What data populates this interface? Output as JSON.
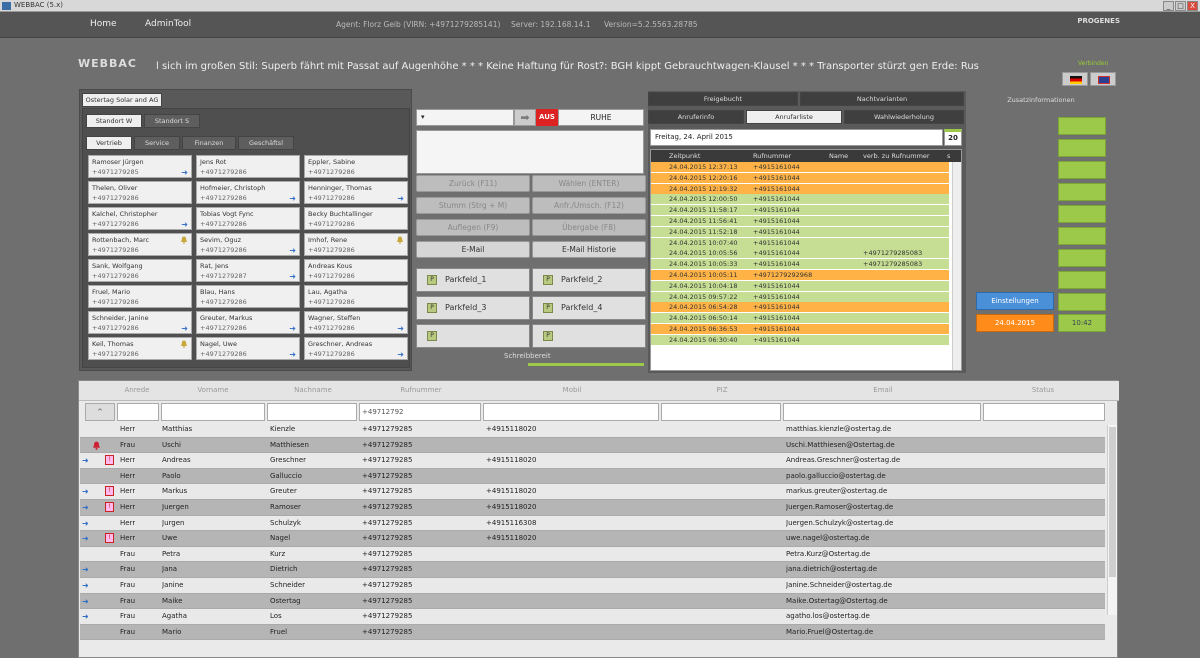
{
  "window": {
    "title": "WEBBAC (5.x)",
    "buttons": [
      "_",
      "□",
      "X"
    ]
  },
  "menu": {
    "home": "Home",
    "admin": "AdminTool",
    "agent": "Agent: Florz Geib  (VIRN: +4971279285141)",
    "server": "Server: 192.168.14.1",
    "version": "Version=5.2.5563.28785",
    "logo": "PROGENES"
  },
  "app_name": "WEBBAC",
  "ticker": "l sich im großen Stil: Superb fährt mit Passat auf Augenhöhe   * * *   Keine Haftung für Rost?: BGH kippt Gebrauchtwagen-Klausel   * * *   Transporter stürzt gen Erde: Rus",
  "green_label": "Verbinden",
  "colors": {
    "accent_green": "#9dc94a",
    "orange": "#ffb347",
    "blue": "#4a90d9"
  },
  "contacts_panel": {
    "company": "Ostertag Solar and AG",
    "location_tabs": [
      "Standort W",
      "Standort S"
    ],
    "dept_tabs": [
      "Vertrieb",
      "Service",
      "Finanzen",
      "Geschäftsl"
    ],
    "contacts": [
      {
        "name": "Ramoser Jürgen",
        "phone": "+4971279285",
        "arrow": true,
        "bell": false
      },
      {
        "name": "Jens Rot",
        "phone": "+4971279286",
        "arrow": false,
        "bell": false
      },
      {
        "name": "Eppler, Sabine",
        "phone": "+4971279286",
        "arrow": false,
        "bell": false
      },
      {
        "name": "Thelen, Oliver",
        "phone": "+4971279286",
        "arrow": false,
        "bell": false
      },
      {
        "name": "Hofmeier, Christoph",
        "phone": "+4971279286",
        "arrow": true,
        "bell": false
      },
      {
        "name": "Henninger, Thomas",
        "phone": "+4971279286",
        "arrow": true,
        "bell": false
      },
      {
        "name": "Kalchel, Christopher",
        "phone": "+4971279286",
        "arrow": true,
        "bell": false
      },
      {
        "name": "Tobias Vogt Fync",
        "phone": "+4971279286",
        "arrow": false,
        "bell": false
      },
      {
        "name": "Becky Buchtallinger",
        "phone": "+4971279286",
        "arrow": false,
        "bell": false
      },
      {
        "name": "Rottenbach, Marc",
        "phone": "+4971279286",
        "arrow": false,
        "bell": true
      },
      {
        "name": "Sevim, Oguz",
        "phone": "+4971279286",
        "arrow": true,
        "bell": false
      },
      {
        "name": "Imhof, Rene",
        "phone": "+4971279286",
        "arrow": false,
        "bell": true
      },
      {
        "name": "Sank, Wolfgang",
        "phone": "+4971279286",
        "arrow": false,
        "bell": false
      },
      {
        "name": "Rat, Jens",
        "phone": "+4971279287",
        "arrow": true,
        "bell": false
      },
      {
        "name": "Andreas Kous",
        "phone": "+4971279286",
        "arrow": false,
        "bell": false
      },
      {
        "name": "Fruel, Mario",
        "phone": "+4971279286",
        "arrow": false,
        "bell": false
      },
      {
        "name": "Blau, Hans",
        "phone": "+4971279286",
        "arrow": false,
        "bell": false
      },
      {
        "name": "Lau, Agatha",
        "phone": "+4971279286",
        "arrow": false,
        "bell": false
      },
      {
        "name": "Schneider, Janine",
        "phone": "+4971279286",
        "arrow": true,
        "bell": false
      },
      {
        "name": "Greuter, Markus",
        "phone": "+4971279286",
        "arrow": true,
        "bell": false
      },
      {
        "name": "Wagner, Steffen",
        "phone": "+4971279286",
        "arrow": true,
        "bell": false
      },
      {
        "name": "Keil, Thomas",
        "phone": "+4971279286",
        "arrow": false,
        "bell": true
      },
      {
        "name": "Nagel, Uwe",
        "phone": "+4971279286",
        "arrow": true,
        "bell": false
      },
      {
        "name": "Greschner, Andreas",
        "phone": "+4971279286",
        "arrow": true,
        "bell": false
      }
    ]
  },
  "phone": {
    "line_value": "",
    "aus": "AUS",
    "ruhe": "RUHE",
    "buttons": [
      {
        "label": "Zurück (F11)",
        "enabled": false
      },
      {
        "label": "Wählen (ENTER)",
        "enabled": false
      },
      {
        "label": "Stumm (Strg + M)",
        "enabled": false
      },
      {
        "label": "Anfr./Umsch. (F12)",
        "enabled": false
      },
      {
        "label": "Auflegen (F9)",
        "enabled": false
      },
      {
        "label": "Übergabe (F8)",
        "enabled": false
      },
      {
        "label": "E-Mail",
        "enabled": true
      },
      {
        "label": "E-Mail Historie",
        "enabled": true
      }
    ],
    "parkfields": [
      "Parkfeld_1",
      "Parkfeld_2",
      "Parkfeld_3",
      "Parkfeld_4",
      "",
      ""
    ],
    "status": "Schreibbereit"
  },
  "calls": {
    "top_tabs": [
      "Freigebucht",
      "Nachtvarianten"
    ],
    "sub_tabs": [
      "Anruferinfo",
      "Anrufarliste",
      "Wahlwiederholung"
    ],
    "date": "Freitag, 24. April 2015",
    "date_btn": "20",
    "columns": [
      "Zeitpunkt",
      "Rufnummer",
      "Name",
      "verb. zu Rufnummer",
      "s"
    ],
    "rows": [
      {
        "time": "24.04.2015 12:37:13",
        "number": "+4915161044",
        "name": "",
        "conn": "",
        "color": "orange"
      },
      {
        "time": "24.04.2015 12:20:16",
        "number": "+4915161044",
        "name": "",
        "conn": "",
        "color": "orange"
      },
      {
        "time": "24.04.2015 12:19:32",
        "number": "+4915161044",
        "name": "",
        "conn": "",
        "color": "orange"
      },
      {
        "time": "24.04.2015 12:00:50",
        "number": "+4915161044",
        "name": "",
        "conn": "",
        "color": "green"
      },
      {
        "time": "24.04.2015 11:58:17",
        "number": "+4915161044",
        "name": "",
        "conn": "",
        "color": "green"
      },
      {
        "time": "24.04.2015 11:56:41",
        "number": "+4915161044",
        "name": "",
        "conn": "",
        "color": "green"
      },
      {
        "time": "24.04.2015 11:52:18",
        "number": "+4915161044",
        "name": "",
        "conn": "",
        "color": "green"
      },
      {
        "time": "24.04.2015 10:07:40",
        "number": "+4915161044",
        "name": "",
        "conn": "",
        "color": "green"
      },
      {
        "time": "24.04.2015 10:05:56",
        "number": "+4915161044",
        "name": "",
        "conn": "+4971279285083",
        "color": "green"
      },
      {
        "time": "24.04.2015 10:05:33",
        "number": "+4915161044",
        "name": "",
        "conn": "+4971279285083",
        "color": "green"
      },
      {
        "time": "24.04.2015 10:05:11",
        "number": "+4971279292968",
        "name": "",
        "conn": "",
        "color": "orange"
      },
      {
        "time": "24.04.2015 10:04:18",
        "number": "+4915161044",
        "name": "",
        "conn": "",
        "color": "green"
      },
      {
        "time": "24.04.2015 09:57:22",
        "number": "+4915161044",
        "name": "",
        "conn": "",
        "color": "green"
      },
      {
        "time": "24.04.2015 06:54:28",
        "number": "+4915161044",
        "name": "",
        "conn": "",
        "color": "orange"
      },
      {
        "time": "24.04.2015 06:50:14",
        "number": "+4915161044",
        "name": "",
        "conn": "",
        "color": "green"
      },
      {
        "time": "24.04.2015 06:36:53",
        "number": "+4915161044",
        "name": "",
        "conn": "",
        "color": "orange"
      },
      {
        "time": "24.04.2015 06:30:40",
        "number": "+4915161044",
        "name": "",
        "conn": "",
        "color": "green"
      }
    ]
  },
  "extra": {
    "title": "Zusatzinformationen",
    "settings": "Einstellungen",
    "date_btn": "24.04.2015",
    "time": "10:42"
  },
  "table": {
    "columns": [
      "Anrede",
      "Vorname",
      "Nachname",
      "Rufnummer",
      "Mobil",
      "PIZ",
      "Email",
      "Status"
    ],
    "filter_btn": "^",
    "filter_phone": "+49712792",
    "rows": [
      {
        "icon": "",
        "flag": false,
        "anrede": "Herr",
        "vorname": "Matthias",
        "nachname": "Kienzle",
        "phone": "+4971279285",
        "mobile": "+4915118020",
        "email": "matthias.kienzle@ostertag.de"
      },
      {
        "icon": "bell",
        "flag": false,
        "anrede": "Frau",
        "vorname": "Uschi",
        "nachname": "Matthiesen",
        "phone": "+4971279285",
        "mobile": "",
        "email": "Uschi.Matthiesen@Ostertag.de"
      },
      {
        "icon": "arrow",
        "flag": true,
        "anrede": "Herr",
        "vorname": "Andreas",
        "nachname": "Greschner",
        "phone": "+4971279285",
        "mobile": "+4915118020",
        "email": "Andreas.Greschner@ostertag.de"
      },
      {
        "icon": "",
        "flag": false,
        "anrede": "Herr",
        "vorname": "Paolo",
        "nachname": "Galluccio",
        "phone": "+4971279285",
        "mobile": "",
        "email": "paolo.galluccio@ostertag.de"
      },
      {
        "icon": "arrow",
        "flag": true,
        "anrede": "Herr",
        "vorname": "Markus",
        "nachname": "Greuter",
        "phone": "+4971279285",
        "mobile": "+4915118020",
        "email": "markus.greuter@ostertag.de"
      },
      {
        "icon": "arrow",
        "flag": true,
        "anrede": "Herr",
        "vorname": "Juergen",
        "nachname": "Ramoser",
        "phone": "+4971279285",
        "mobile": "+4915118020",
        "email": "Juergen.Ramoser@ostertag.de"
      },
      {
        "icon": "arrow",
        "flag": false,
        "anrede": "Herr",
        "vorname": "Jurgen",
        "nachname": "Schulzyk",
        "phone": "+4971279285",
        "mobile": "+4915116308",
        "email": "Juergen.Schulzyk@ostertag.de"
      },
      {
        "icon": "arrow",
        "flag": true,
        "anrede": "Herr",
        "vorname": "Uwe",
        "nachname": "Nagel",
        "phone": "+4971279285",
        "mobile": "+4915118020",
        "email": "uwe.nagel@ostertag.de"
      },
      {
        "icon": "",
        "flag": false,
        "anrede": "Frau",
        "vorname": "Petra",
        "nachname": "Kurz",
        "phone": "+4971279285",
        "mobile": "",
        "email": "Petra.Kurz@Ostertag.de"
      },
      {
        "icon": "arrow",
        "flag": false,
        "anrede": "Frau",
        "vorname": "Jana",
        "nachname": "Dietrich",
        "phone": "+4971279285",
        "mobile": "",
        "email": "jana.dietrich@ostertag.de"
      },
      {
        "icon": "arrow",
        "flag": false,
        "anrede": "Frau",
        "vorname": "Janine",
        "nachname": "Schneider",
        "phone": "+4971279285",
        "mobile": "",
        "email": "Janine.Schneider@ostertag.de"
      },
      {
        "icon": "arrow",
        "flag": false,
        "anrede": "Frau",
        "vorname": "Maike",
        "nachname": "Ostertag",
        "phone": "+4971279285",
        "mobile": "",
        "email": "Maike.Ostertag@Ostertag.de"
      },
      {
        "icon": "arrow",
        "flag": false,
        "anrede": "Frau",
        "vorname": "Agatha",
        "nachname": "Los",
        "phone": "+4971279285",
        "mobile": "",
        "email": "agatho.los@ostertag.de"
      },
      {
        "icon": "",
        "flag": false,
        "anrede": "Frau",
        "vorname": "Mario",
        "nachname": "Fruel",
        "phone": "+4971279285",
        "mobile": "",
        "email": "Mario.Fruel@Ostertag.de"
      }
    ]
  }
}
